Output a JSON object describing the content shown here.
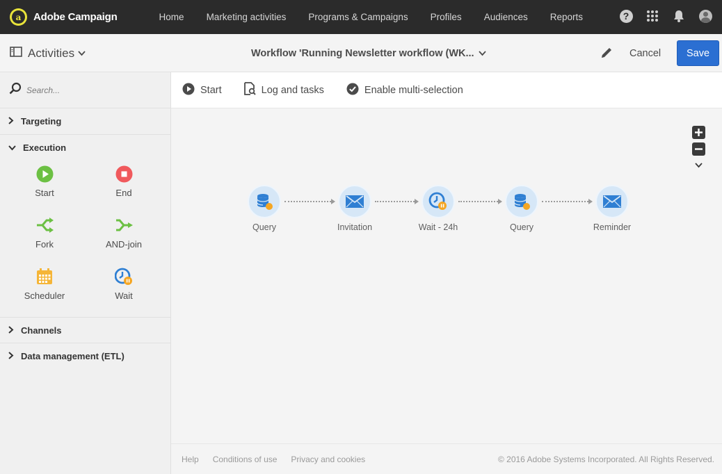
{
  "app": {
    "title": "Adobe Campaign",
    "logo_letter": "a"
  },
  "nav": {
    "items": [
      "Home",
      "Marketing activities",
      "Programs & Campaigns",
      "Profiles",
      "Audiences",
      "Reports"
    ]
  },
  "top_icons": [
    "help-icon",
    "apps-grid-icon",
    "bell-icon",
    "user-avatar"
  ],
  "header": {
    "activities_label": "Activities",
    "workflow_title": "Workflow 'Running Newsletter workflow (WK...",
    "cancel_label": "Cancel",
    "save_label": "Save"
  },
  "sidebar": {
    "search_placeholder": "Search...",
    "sections": {
      "targeting": "Targeting",
      "execution": "Execution",
      "channels": "Channels",
      "data_management": "Data management (ETL)"
    },
    "execution_items": [
      {
        "label": "Start",
        "icon": "start-icon"
      },
      {
        "label": "End",
        "icon": "end-icon"
      },
      {
        "label": "Fork",
        "icon": "fork-icon"
      },
      {
        "label": "AND-join",
        "icon": "and-join-icon"
      },
      {
        "label": "Scheduler",
        "icon": "scheduler-icon"
      },
      {
        "label": "Wait",
        "icon": "wait-icon"
      }
    ]
  },
  "toolbar": {
    "start_label": "Start",
    "log_label": "Log and tasks",
    "multi_label": "Enable multi-selection"
  },
  "workflow_nodes": [
    {
      "label": "Query",
      "icon": "query-icon"
    },
    {
      "label": "Invitation",
      "icon": "email-icon"
    },
    {
      "label": "Wait - 24h",
      "icon": "wait-icon"
    },
    {
      "label": "Query",
      "icon": "query-icon"
    },
    {
      "label": "Reminder",
      "icon": "email-icon"
    }
  ],
  "footer": {
    "help": "Help",
    "conditions": "Conditions of use",
    "privacy": "Privacy and cookies",
    "copyright": "© 2016 Adobe Systems Incorporated. All Rights Reserved."
  },
  "colors": {
    "topbar": "#2b2b2b",
    "save_button": "#2b6fd2",
    "node_fill": "#d6e7f7",
    "node_icon": "#2f7fd3",
    "green": "#6cc043",
    "red": "#f0595c",
    "orange": "#f5a623"
  }
}
